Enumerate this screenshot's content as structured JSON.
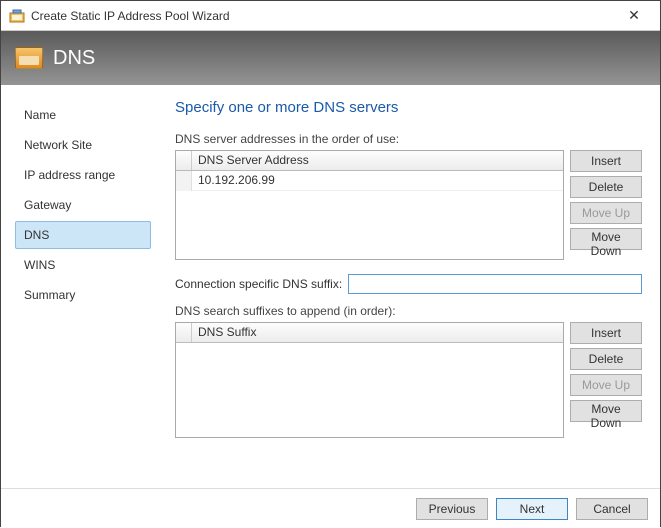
{
  "window": {
    "title": "Create Static IP Address Pool Wizard",
    "banner": "DNS"
  },
  "nav": {
    "items": [
      {
        "label": "Name"
      },
      {
        "label": "Network Site"
      },
      {
        "label": "IP address range"
      },
      {
        "label": "Gateway"
      },
      {
        "label": "DNS"
      },
      {
        "label": "WINS"
      },
      {
        "label": "Summary"
      }
    ],
    "selected": "DNS"
  },
  "page": {
    "heading": "Specify one or more DNS servers",
    "serverAddresses": {
      "label": "DNS server addresses in the order of use:",
      "columnHeader": "DNS Server Address",
      "rows": [
        "10.192.206.99"
      ],
      "buttons": {
        "insert": "Insert",
        "delete": "Delete",
        "moveUp": "Move Up",
        "moveDown": "Move Down"
      }
    },
    "suffix": {
      "label": "Connection specific DNS suffix:",
      "value": ""
    },
    "searchSuffixes": {
      "label": "DNS search suffixes to append (in order):",
      "columnHeader": "DNS Suffix",
      "rows": [],
      "buttons": {
        "insert": "Insert",
        "delete": "Delete",
        "moveUp": "Move Up",
        "moveDown": "Move Down"
      }
    }
  },
  "footer": {
    "previous": "Previous",
    "next": "Next",
    "cancel": "Cancel"
  }
}
